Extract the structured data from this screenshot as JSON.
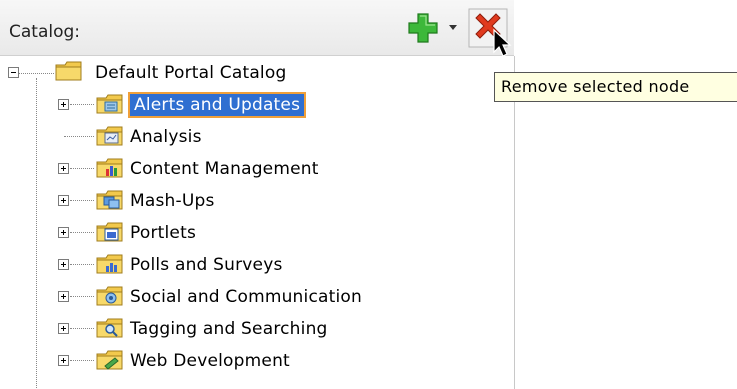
{
  "catalog": {
    "label": "Catalog:",
    "add_icon": "add-plus-icon",
    "remove_icon": "remove-x-icon",
    "tooltip": "Remove selected node",
    "root": {
      "label": "Default Portal Catalog",
      "icon": "folder-icon"
    },
    "items": [
      {
        "label": "Alerts and Updates",
        "icon": "folder-alerts-icon",
        "selected": true
      },
      {
        "label": "Analysis",
        "icon": "folder-analysis-icon"
      },
      {
        "label": "Content Management",
        "icon": "folder-content-icon"
      },
      {
        "label": "Mash-Ups",
        "icon": "folder-mashups-icon"
      },
      {
        "label": "Portlets",
        "icon": "folder-portlets-icon"
      },
      {
        "label": "Polls and Surveys",
        "icon": "folder-polls-icon"
      },
      {
        "label": "Social and Communication",
        "icon": "folder-social-icon"
      },
      {
        "label": "Tagging and Searching",
        "icon": "folder-tagging-icon"
      },
      {
        "label": "Web Development",
        "icon": "folder-web-icon"
      }
    ]
  },
  "colors": {
    "selection": "#2f6fd1",
    "selection_border": "#f0a03a",
    "add_green": "#3db83a",
    "remove_red": "#e03a1e",
    "tooltip_bg": "#ffffe1"
  }
}
